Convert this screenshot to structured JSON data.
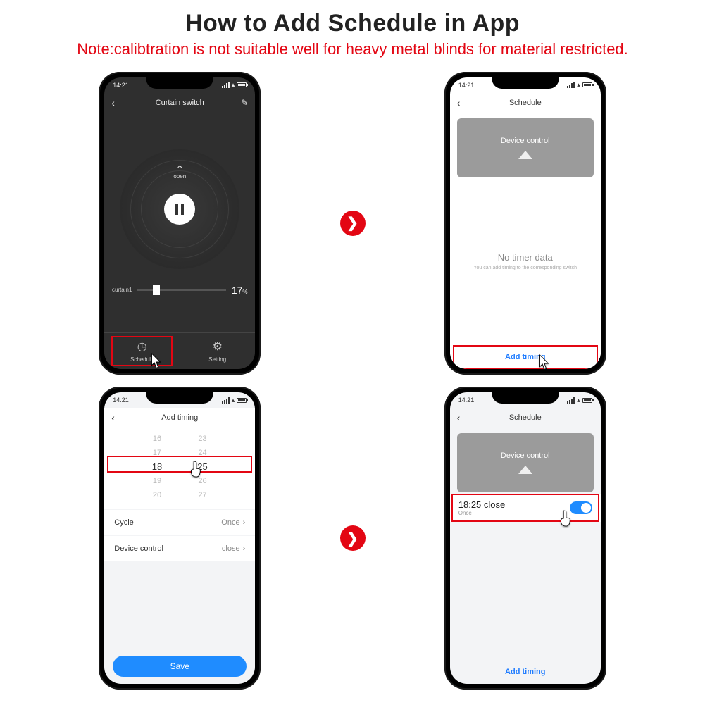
{
  "title": "How to Add Schedule in App",
  "note": "Note:calibtration is not suitable well for heavy metal blinds for material restricted.",
  "status_time": "14:21",
  "screen1": {
    "title": "Curtain switch",
    "open_label": "open",
    "slider_label": "curtain1",
    "percent": "17",
    "percent_unit": "%",
    "tab_schedule": "Schedule",
    "tab_setting": "Setting"
  },
  "screen2": {
    "title": "Schedule",
    "device_control": "Device control",
    "empty_h": "No timer data",
    "empty_s": "You can add timing to the corresponding switch",
    "add_timing": "Add timing"
  },
  "screen3": {
    "title": "Add timing",
    "hours": [
      "16",
      "17",
      "18",
      "19",
      "20"
    ],
    "mins": [
      "23",
      "24",
      "25",
      "26",
      "27"
    ],
    "cycle_label": "Cycle",
    "cycle_value": "Once",
    "device_label": "Device control",
    "device_value": "close",
    "save": "Save"
  },
  "screen4": {
    "title": "Schedule",
    "device_control": "Device control",
    "row_time": "18:25 close",
    "row_sub": "Once",
    "add_timing": "Add timing"
  }
}
